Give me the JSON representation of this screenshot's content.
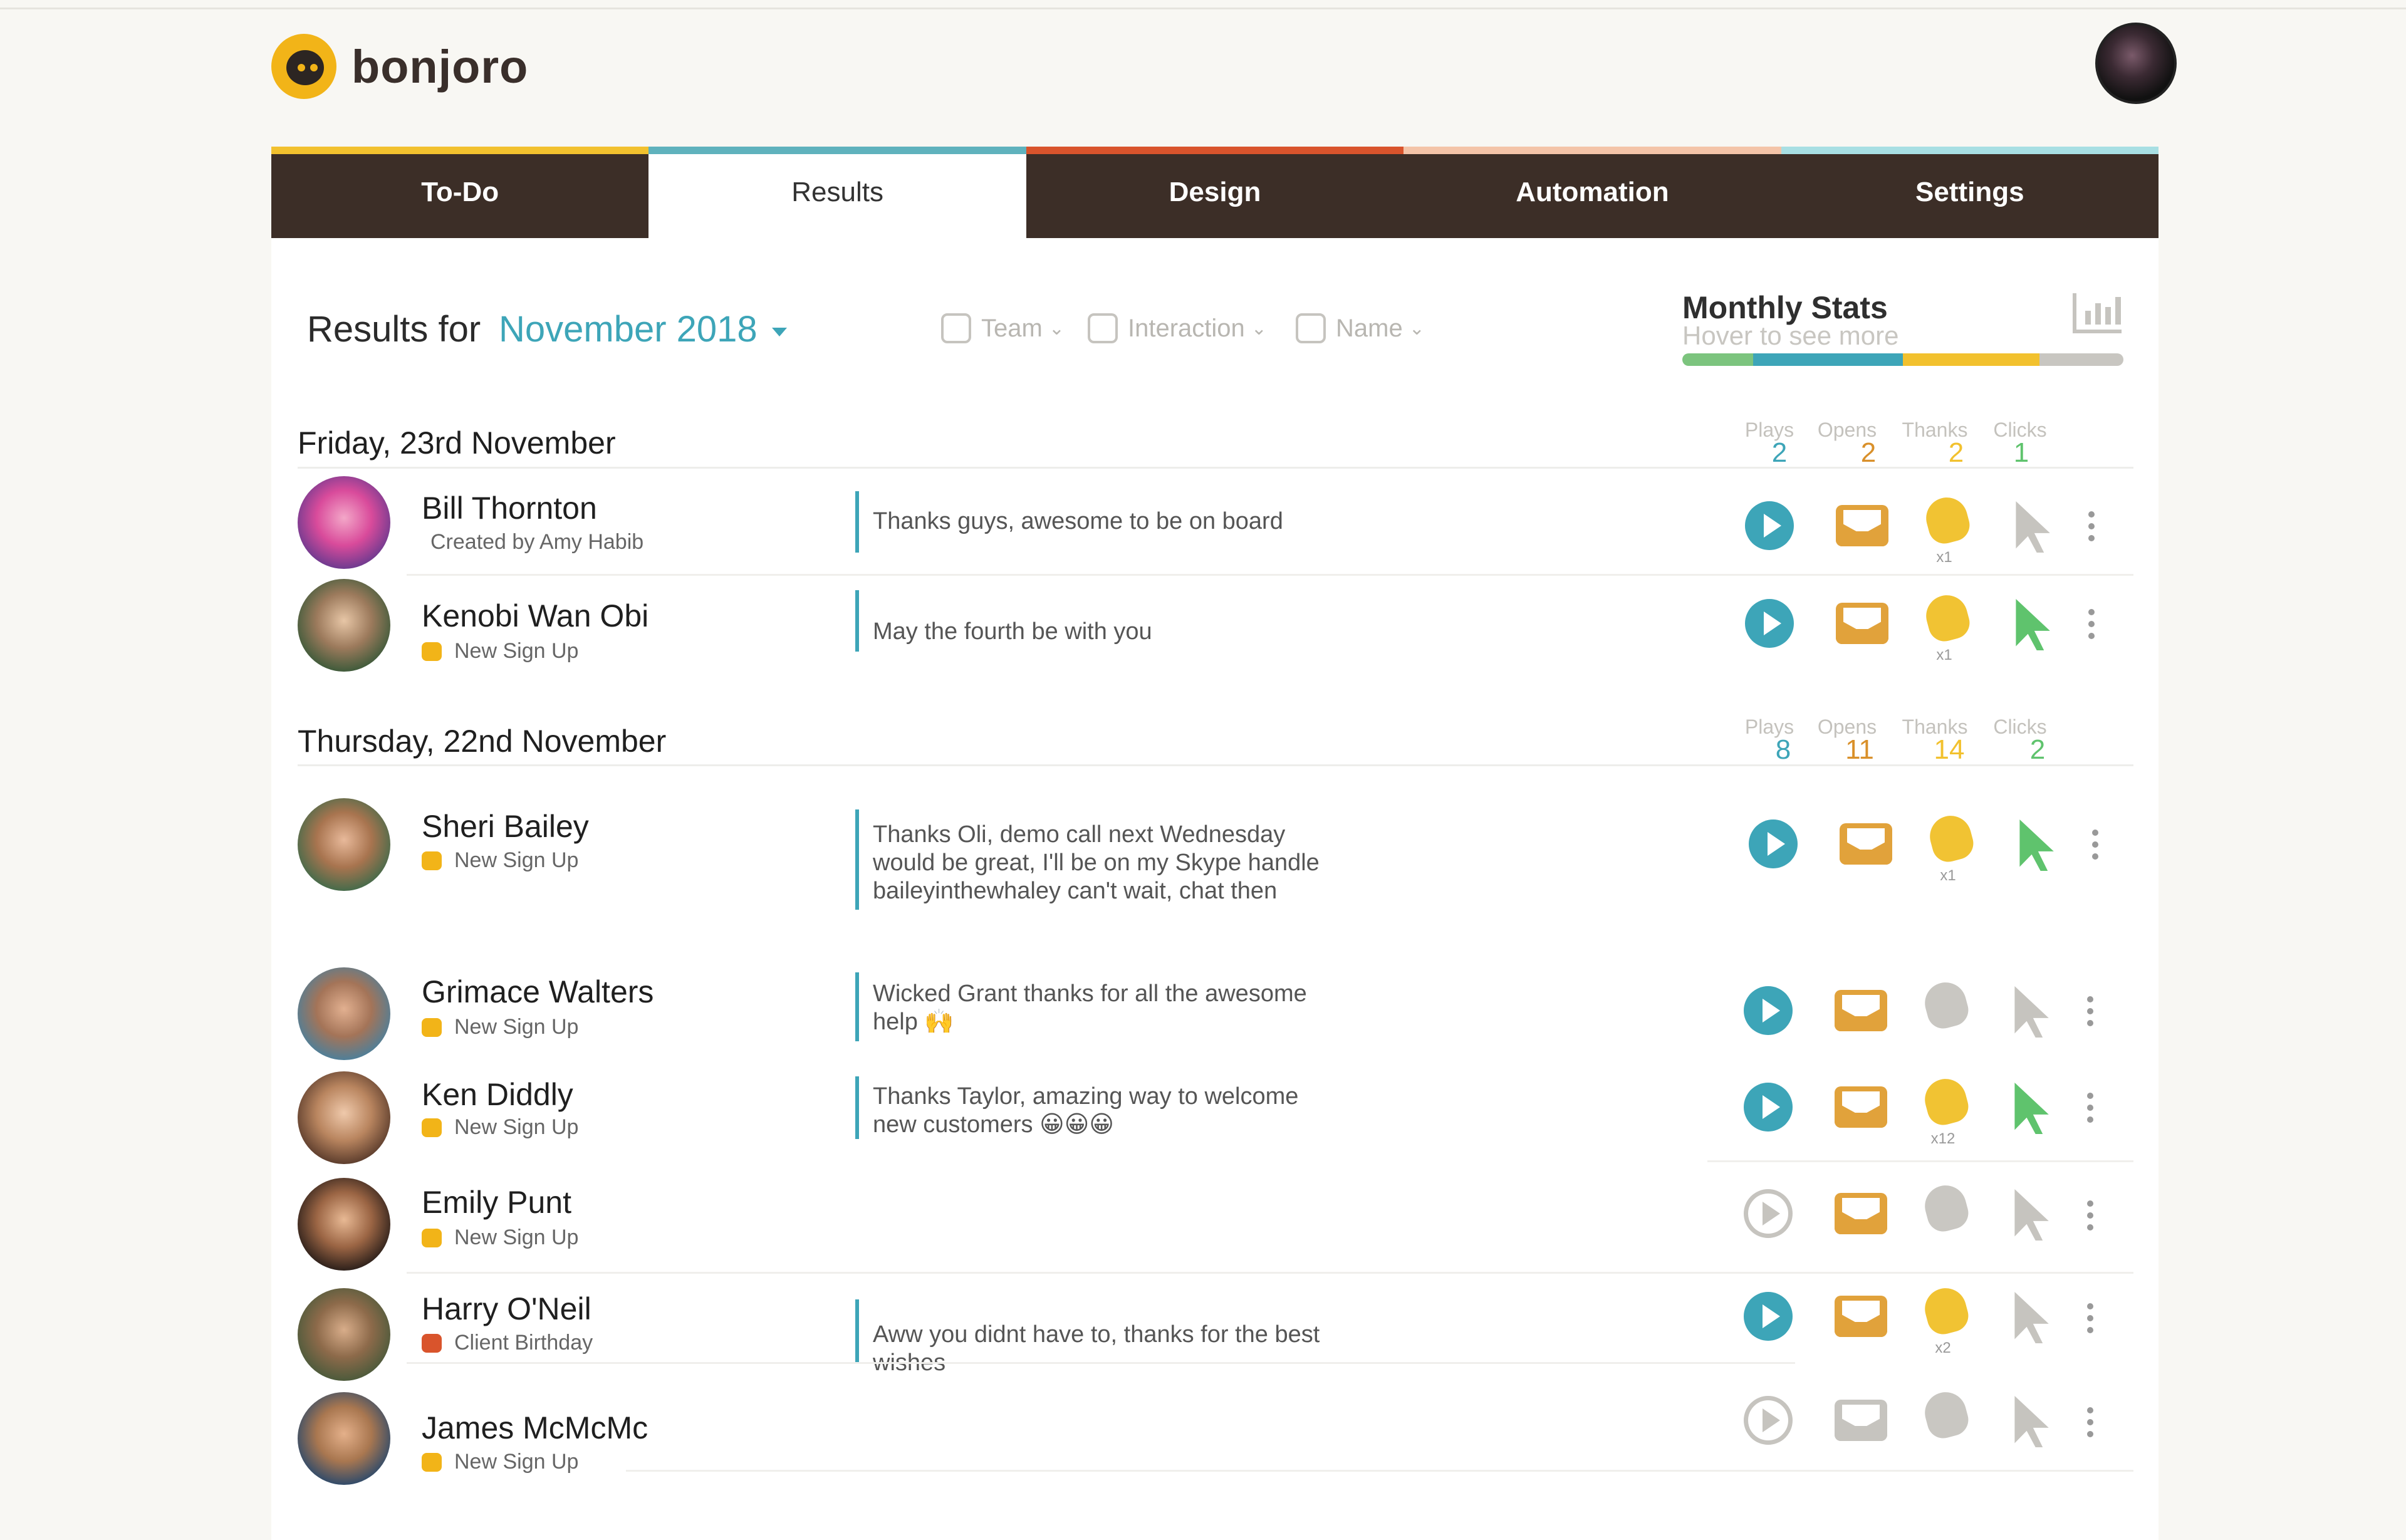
{
  "app": {
    "name": "bonjoro"
  },
  "tabs": [
    {
      "label": "To-Do",
      "color": "#f2c12e"
    },
    {
      "label": "Results",
      "color": "#5fb2bd"
    },
    {
      "label": "Design",
      "color": "#d9542c"
    },
    {
      "label": "Automation",
      "color": "#f4c4a8"
    },
    {
      "label": "Settings",
      "color": "#a8dfe3"
    }
  ],
  "header": {
    "results_for": "Results for",
    "month": "November 2018"
  },
  "filters": [
    {
      "label": "Team",
      "icon": "team-icon"
    },
    {
      "label": "Interaction",
      "icon": "interaction-icon"
    },
    {
      "label": "Name",
      "icon": "name-search-icon"
    }
  ],
  "monthly_stats": {
    "title": "Monthly Stats",
    "hint": "Hover to see more",
    "colors": [
      "#7cc47e",
      "#3da5b8",
      "#f2c12e",
      "#c8c6c1"
    ]
  },
  "column_headers": [
    "Plays",
    "Opens",
    "Thanks",
    "Clicks"
  ],
  "groups": [
    {
      "date": "Friday, 23rd November",
      "stats": {
        "plays": "2",
        "opens": "2",
        "thanks": "2",
        "clicks": "1"
      },
      "rows": [
        {
          "name": "Bill Thornton",
          "sub": "Created by Amy Habib",
          "tag": "",
          "message": "Thanks guys, awesome to be on board",
          "thanks_count": "x1"
        },
        {
          "name": "Kenobi Wan Obi",
          "sub": "New Sign Up",
          "tag": "signup",
          "message": "May the fourth be with you",
          "thanks_count": "x1"
        }
      ]
    },
    {
      "date": "Thursday, 22nd November",
      "stats": {
        "plays": "8",
        "opens": "11",
        "thanks": "14",
        "clicks": "2"
      },
      "rows": [
        {
          "name": "Sheri Bailey",
          "sub": "New Sign Up",
          "tag": "signup",
          "message_lines": [
            "Thanks Oli, demo call next Wednesday",
            "would be great, I'll be on my Skype handle",
            "baileyinthewhaley can't wait, chat then"
          ],
          "thanks_count": "x1"
        },
        {
          "name": "Grimace Walters",
          "sub": "New Sign Up",
          "tag": "signup",
          "message_lines": [
            "Wicked Grant thanks for all the awesome",
            "help 🙌"
          ]
        },
        {
          "name": "Ken Diddly",
          "sub": "New Sign Up",
          "tag": "signup",
          "message_lines": [
            "Thanks Taylor, amazing way to welcome",
            "new customers 😀😀😀"
          ],
          "thanks_count": "x12"
        },
        {
          "name": "Emily Punt",
          "sub": "New Sign Up",
          "tag": "signup"
        },
        {
          "name": "Harry O'Neil",
          "sub": "Client Birthday",
          "tag": "birthday",
          "message_lines": [
            "Aww you didnt have to, thanks for the best",
            "wishes"
          ],
          "thanks_count": "x2"
        },
        {
          "name": "James McMcMc",
          "sub": "New Sign Up",
          "tag": "signup"
        }
      ]
    }
  ]
}
